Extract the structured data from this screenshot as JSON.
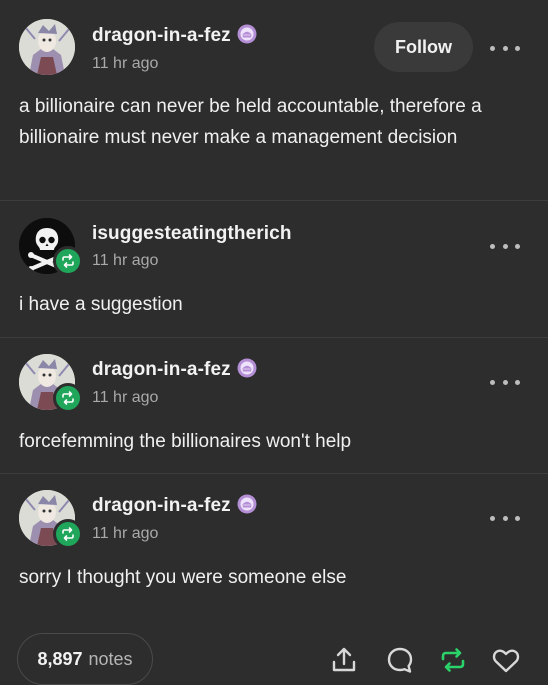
{
  "posts": [
    {
      "username": "dragon-in-a-fez",
      "time": "11 hr ago",
      "text": "a billionaire can never be held accountable, therefore a billionaire must never make a management decision",
      "has_follow": true,
      "avatar": "dragon-in-a-fez-avatar",
      "badge_icon": "cake-badge-icon"
    },
    {
      "username": "isuggesteatingtherich",
      "time": "11 hr ago",
      "text": "i have a suggestion",
      "avatar": "skull-crossbones-avatar",
      "reblog_badge": true
    },
    {
      "username": "dragon-in-a-fez",
      "time": "11 hr ago",
      "text": "forcefemming the billionaires won't help",
      "avatar": "dragon-in-a-fez-avatar",
      "badge_icon": "cake-badge-icon",
      "reblog_badge": true
    },
    {
      "username": "dragon-in-a-fez",
      "time": "11 hr ago",
      "text": "sorry I thought you were someone else",
      "avatar": "dragon-in-a-fez-avatar",
      "badge_icon": "cake-badge-icon",
      "reblog_badge": true
    }
  ],
  "follow_label": "Follow",
  "footer": {
    "notes_count": "8,897",
    "notes_label": "notes",
    "actions": [
      "share-icon",
      "reply-icon",
      "reblog-icon",
      "like-icon"
    ]
  },
  "colors": {
    "background": "#2d2d2d",
    "reblog_green": "#1fa65a",
    "badge_purple": "#b48fd6"
  }
}
